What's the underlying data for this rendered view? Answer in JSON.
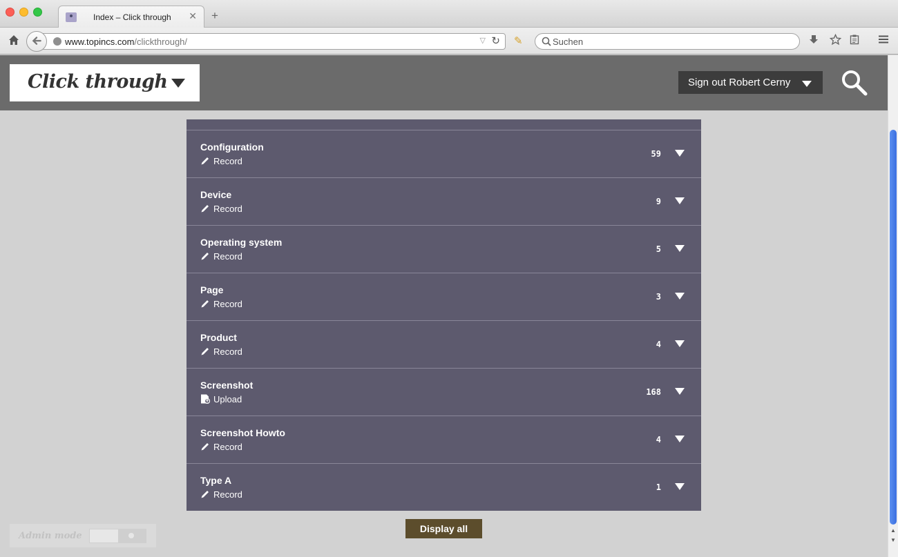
{
  "browser": {
    "tab_title": "Index – Click through",
    "tab_close": "✕",
    "new_tab": "+",
    "url_host": "www.topincs.com",
    "url_path": "/clickthrough/",
    "url_dropdown": "▽",
    "url_reload": "↻",
    "search_placeholder": "Suchen"
  },
  "header": {
    "brand": "Click through",
    "signout_label": "Sign out Robert Cerny"
  },
  "rows": [
    {
      "title": "Configuration",
      "action": "Record",
      "action_icon": "pencil-icon",
      "count": "59"
    },
    {
      "title": "Device",
      "action": "Record",
      "action_icon": "pencil-icon",
      "count": "9"
    },
    {
      "title": "Operating system",
      "action": "Record",
      "action_icon": "pencil-icon",
      "count": "5"
    },
    {
      "title": "Page",
      "action": "Record",
      "action_icon": "pencil-icon",
      "count": "3"
    },
    {
      "title": "Product",
      "action": "Record",
      "action_icon": "pencil-icon",
      "count": "4"
    },
    {
      "title": "Screenshot",
      "action": "Upload",
      "action_icon": "upload-icon",
      "count": "168"
    },
    {
      "title": "Screenshot Howto",
      "action": "Record",
      "action_icon": "pencil-icon",
      "count": "4"
    },
    {
      "title": "Type A",
      "action": "Record",
      "action_icon": "pencil-icon",
      "count": "1"
    }
  ],
  "display_all_label": "Display all",
  "admin": {
    "label": "Admin mode"
  }
}
